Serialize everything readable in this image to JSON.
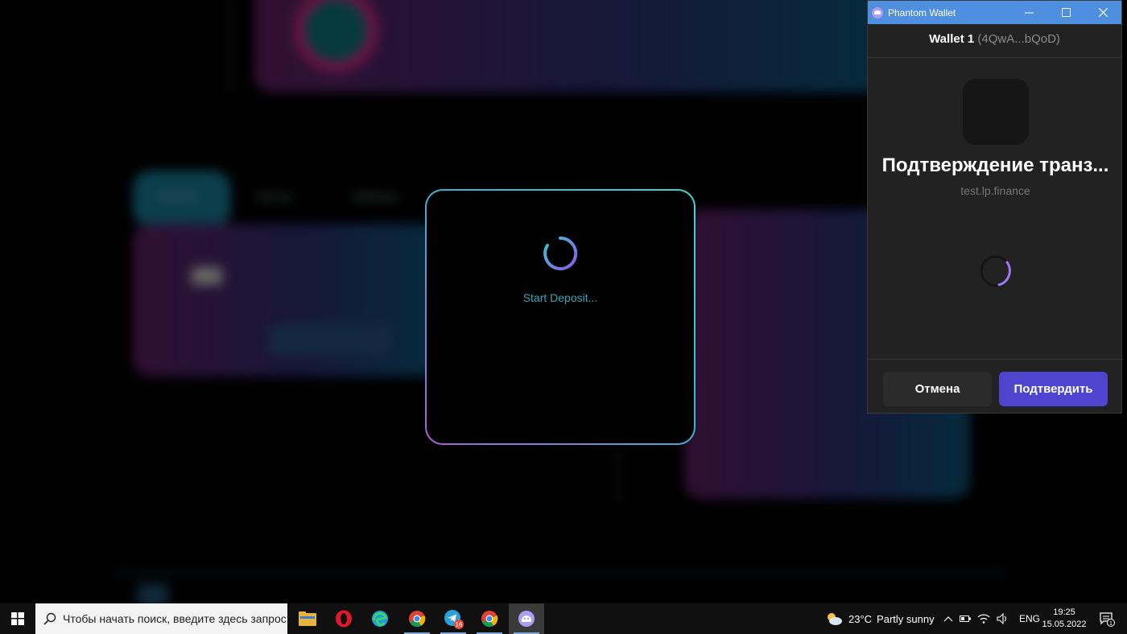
{
  "modal": {
    "status_text": "Start Deposit..."
  },
  "phantom": {
    "window_title": "Phantom Wallet",
    "wallet_name": "Wallet 1",
    "wallet_address": "(4QwA...bQoD)",
    "heading": "Подтверждение транз...",
    "site": "test.lp.finance",
    "cancel_label": "Отмена",
    "confirm_label": "Подтвердить",
    "accent_color": "#4e44ce",
    "titlebar_color": "#4f8fe0"
  },
  "background": {
    "tabs": [
      "Deposit",
      "Borrow",
      "Withdraw"
    ],
    "labels": [
      "Deposit",
      "Total Borrowed",
      "12.98%"
    ]
  },
  "taskbar": {
    "search_placeholder": "Чтобы начать поиск, введите здесь запрос",
    "apps": [
      "file-explorer-icon",
      "opera-icon",
      "edge-icon",
      "chrome-icon",
      "telegram-icon",
      "chrome-icon",
      "phantom-icon"
    ],
    "telegram_badge": "16",
    "weather_temp": "23°C",
    "weather_desc": "Partly sunny",
    "language": "ENG",
    "time": "19:25",
    "date": "15.05.2022",
    "notification_count": "1"
  }
}
